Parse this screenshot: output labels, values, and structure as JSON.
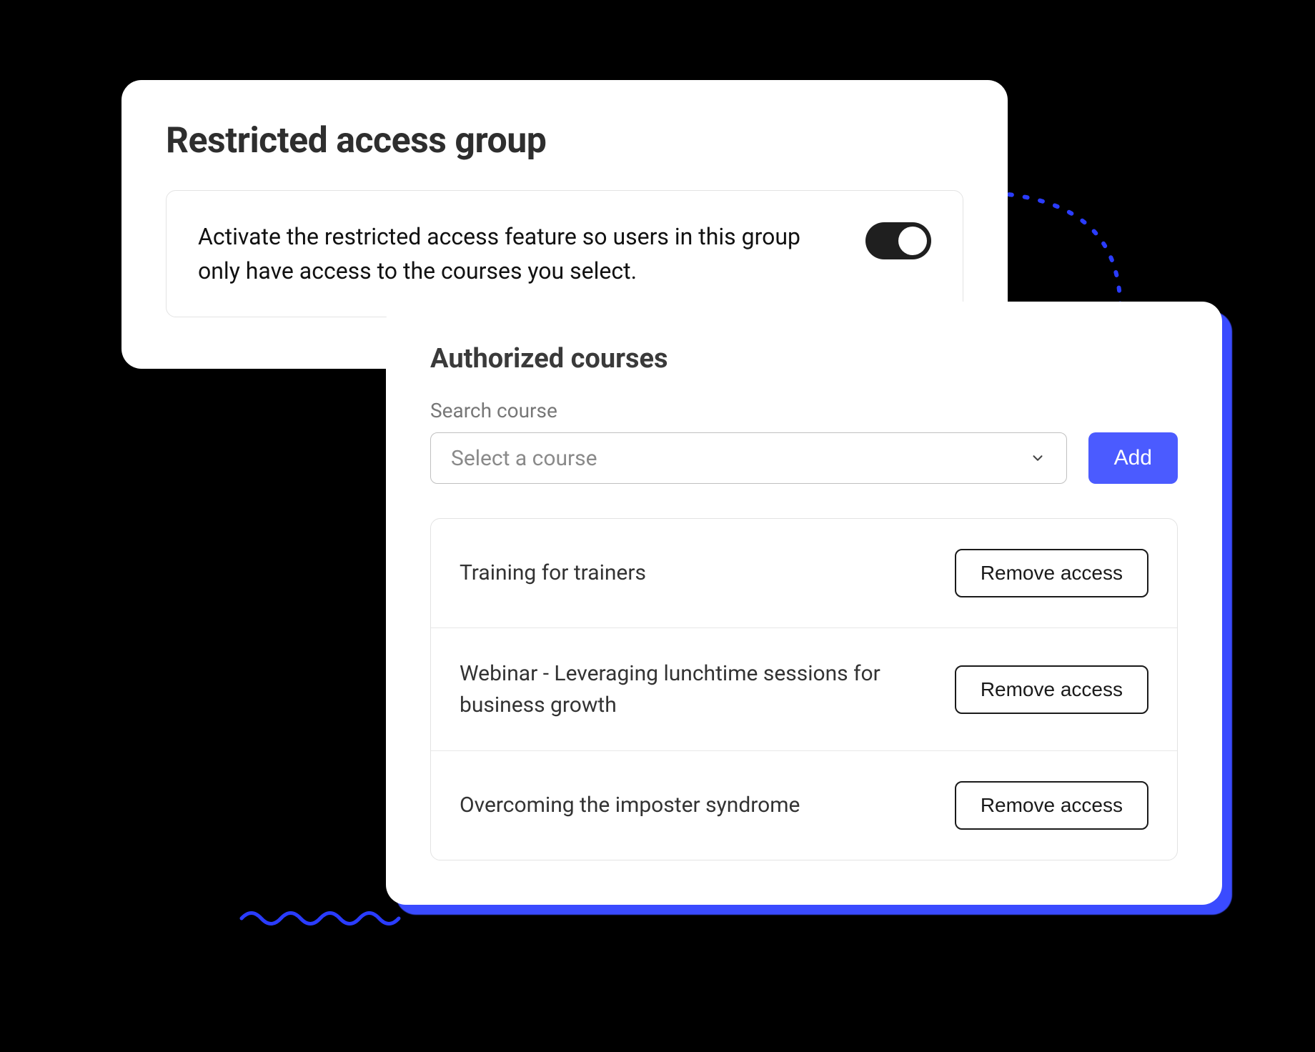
{
  "restricted": {
    "title": "Restricted access group",
    "description": "Activate the restricted access feature so users in this group only have access to the courses you select.",
    "toggle_on": true
  },
  "authorized": {
    "title": "Authorized courses",
    "search_label": "Search course",
    "select_placeholder": "Select a course",
    "add_label": "Add",
    "remove_label": "Remove access",
    "courses": [
      {
        "name": "Training for trainers"
      },
      {
        "name": "Webinar - Leveraging lunchtime sessions for business growth"
      },
      {
        "name": "Overcoming the imposter syndrome"
      }
    ]
  },
  "colors": {
    "accent": "#4b5bff",
    "toggle_bg": "#1f1f1f"
  }
}
